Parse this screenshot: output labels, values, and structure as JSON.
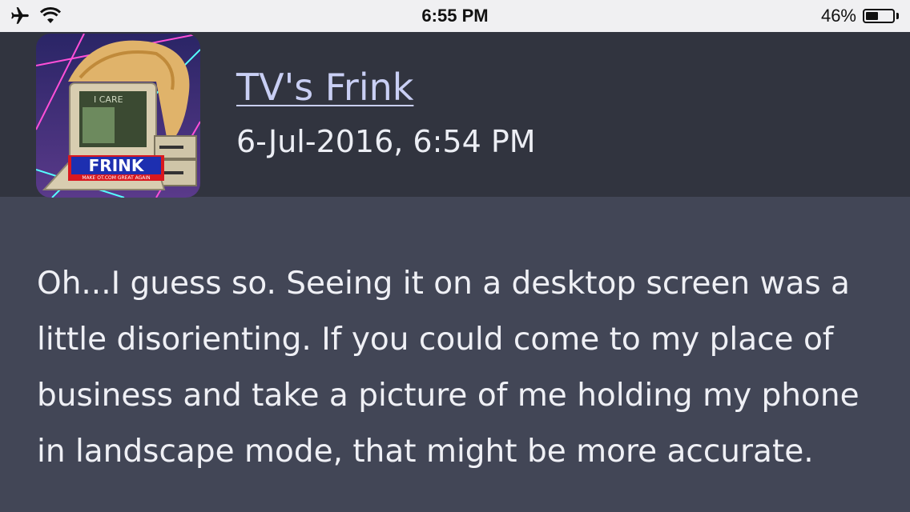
{
  "status_bar": {
    "time": "6:55 PM",
    "battery_percent": "46%",
    "battery_level": 0.46,
    "left_icons": [
      "airplane-icon",
      "wifi-icon"
    ]
  },
  "post": {
    "author": "TV's Frink",
    "date": "6-Jul-2016, 6:54 PM",
    "avatar": {
      "screen_text": "I CARE",
      "banner_text": "FRINK",
      "banner_subtext": "MAKE OT.COM GREAT AGAIN"
    },
    "body": "Oh...I guess so. Seeing it on a desktop screen was a little disorienting. If you could come to my place of business and take a picture of me holding my phone in landscape mode, that might be more accurate."
  },
  "colors": {
    "background": "#424656",
    "header_bg": "#31343f",
    "link": "#c9cff4",
    "text": "#eff0f5"
  }
}
